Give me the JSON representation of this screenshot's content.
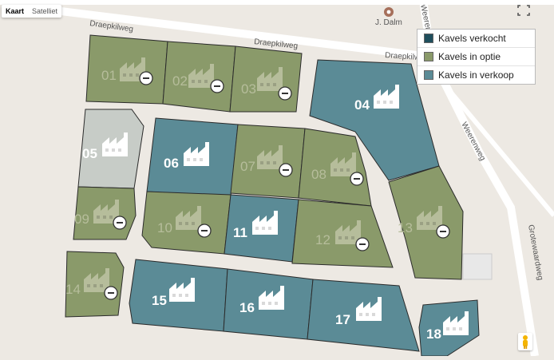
{
  "map_controls": {
    "map_type": [
      "Kaart",
      "Satelliet"
    ],
    "active": "Kaart"
  },
  "legend": [
    {
      "label": "Kavels verkocht",
      "color": "#1f4e5c"
    },
    {
      "label": "Kavels in optie",
      "color": "#8a9a6a"
    },
    {
      "label": "Kavels in verkoop",
      "color": "#5b8b96"
    }
  ],
  "colors": {
    "background": "#ede9e3",
    "road": "#ffffff",
    "optie": "#8a9a6a",
    "verkoop": "#5b8b96",
    "reserved": "#c7ccc7",
    "icon_optie": "#b6bd9b",
    "outline": "#2b2b2b"
  },
  "streets": [
    "Draepkilweg",
    "Draepkilweg",
    "Draepkilweg",
    "Weerenweg",
    "Weerenweg",
    "Grotewaardweg"
  ],
  "poi": {
    "label": "J. Dalm",
    "icon": "map-marker-icon"
  },
  "plots": [
    {
      "num": "01",
      "status": "optie"
    },
    {
      "num": "02",
      "status": "optie"
    },
    {
      "num": "03",
      "status": "optie"
    },
    {
      "num": "04",
      "status": "verkoop"
    },
    {
      "num": "05",
      "status": "reserved"
    },
    {
      "num": "06",
      "status": "verkoop"
    },
    {
      "num": "07",
      "status": "optie"
    },
    {
      "num": "08",
      "status": "optie"
    },
    {
      "num": "09",
      "status": "optie"
    },
    {
      "num": "10",
      "status": "optie"
    },
    {
      "num": "11",
      "status": "verkoop"
    },
    {
      "num": "12",
      "status": "optie"
    },
    {
      "num": "13",
      "status": "optie"
    },
    {
      "num": "14",
      "status": "optie"
    },
    {
      "num": "15",
      "status": "verkoop"
    },
    {
      "num": "16",
      "status": "verkoop"
    },
    {
      "num": "17",
      "status": "verkoop"
    },
    {
      "num": "18",
      "status": "verkoop"
    }
  ],
  "icons": [
    "factory-icon",
    "minus-circle-icon",
    "fullscreen-icon",
    "pegman-icon"
  ]
}
